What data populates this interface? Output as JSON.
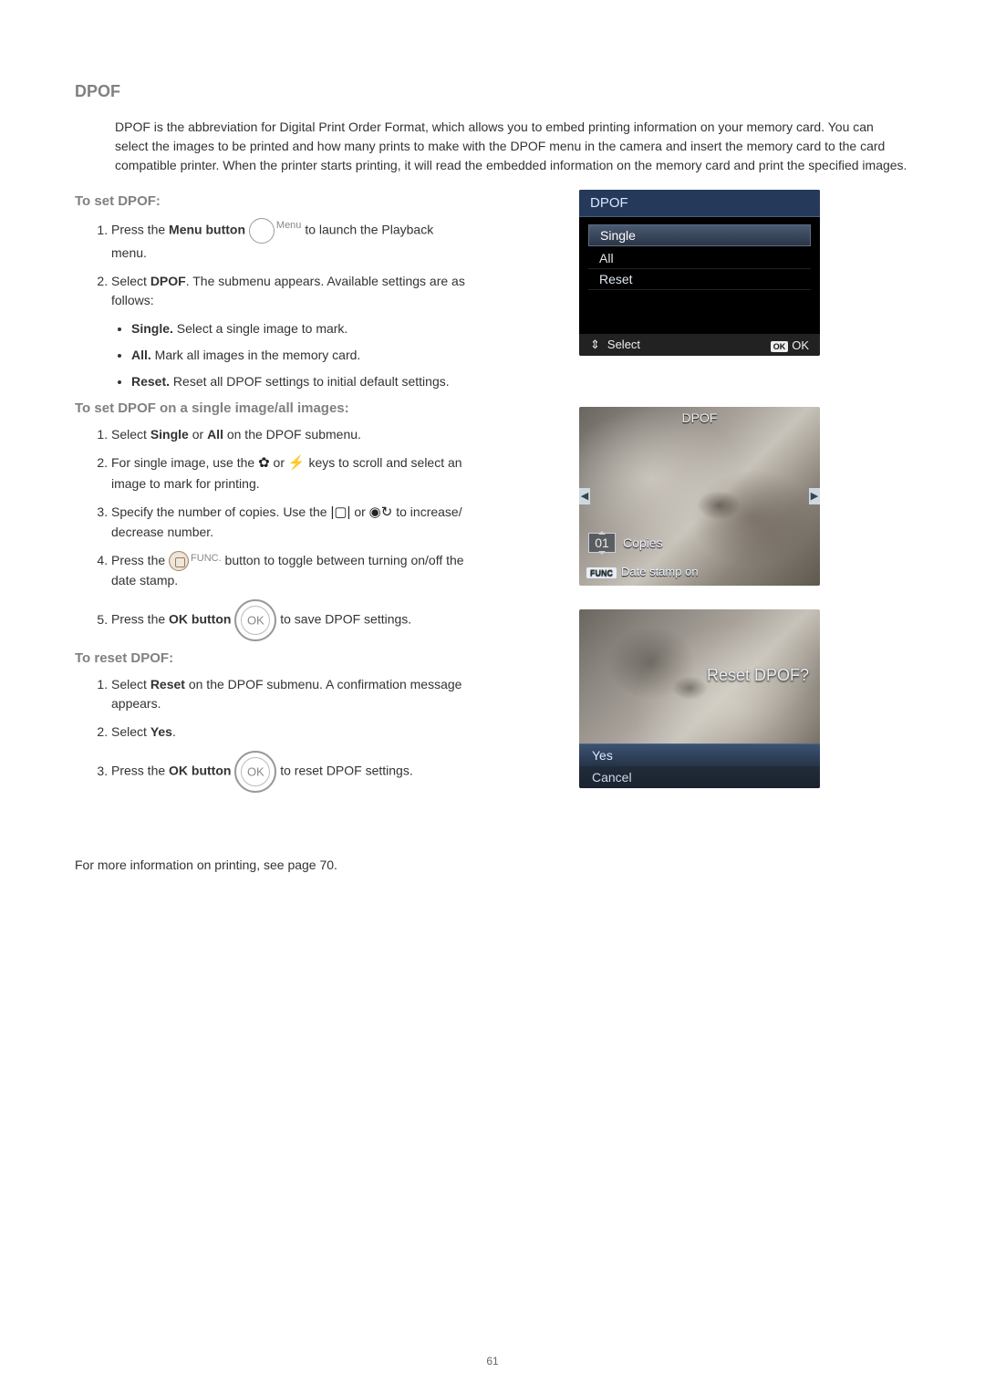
{
  "section_title": "DPOF",
  "intro": "DPOF is the abbreviation for Digital Print Order Format, which allows you to embed printing information on your memory card. You can select the images to be printed and how many prints to make with the DPOF menu in the camera and insert the memory card to the card compatible printer. When the printer starts printing, it will read the embedded information on the memory card and print the specified images.",
  "set_title": "To set DPOF:",
  "set_steps": {
    "s1a": "Press the ",
    "s1_bold": "Menu button",
    "s1_menu_label": "Menu",
    "s1b": " to launch the Playback menu.",
    "s2a": "Select ",
    "s2_bold": "DPOF",
    "s2b": ". The submenu appears. Available settings are as follows:",
    "b1_bold": "Single.",
    "b1": " Select a single image to mark.",
    "b2_bold": "All.",
    "b2": " Mark all images in the memory card.",
    "b3_bold": "Reset.",
    "b3": " Reset all DPOF settings to initial default settings."
  },
  "single_title": "To set DPOF on a single image/all images:",
  "single_steps": {
    "s1a": "Select ",
    "s1_b1": "Single",
    "s1_mid": " or ",
    "s1_b2": "All",
    "s1b": " on the DPOF submenu.",
    "s2a": "For single image, use the ",
    "s2_mid": " or ",
    "s2b": " keys to scroll and select an image to mark for printing.",
    "s3a": "Specify the number of copies. Use the ",
    "s3_mid": " or ",
    "s3b": " to increase/ decrease number.",
    "s4a": "Press the ",
    "s4_func": "FUNC.",
    "s4b": " button to toggle between turning on/off the date stamp.",
    "s5a": "Press the ",
    "s5_bold": "OK button",
    "s5_ok": "OK",
    "s5b": " to save DPOF settings."
  },
  "reset_title": "To reset DPOF:",
  "reset_steps": {
    "s1a": "Select ",
    "s1_bold": "Reset",
    "s1b": " on the DPOF submenu. A confirmation message appears.",
    "s2a": "Select ",
    "s2_bold": "Yes",
    "s2b": ".",
    "s3a": "Press the ",
    "s3_bold": "OK button",
    "s3_ok": "OK",
    "s3b": " to reset DPOF settings."
  },
  "footer_note": "For more information on printing, see page 70.",
  "page_num": "61",
  "screen1": {
    "title": "DPOF",
    "items": [
      "Single",
      "All",
      "Reset"
    ],
    "footer_select": "Select",
    "footer_ok": "OK"
  },
  "screen2": {
    "title": "DPOF",
    "copies_num": "01",
    "copies_label": "Copies",
    "func_badge": "FUNC",
    "date_stamp": "Date stamp on"
  },
  "screen3": {
    "title": "Reset DPOF?",
    "yes": "Yes",
    "cancel": "Cancel"
  }
}
